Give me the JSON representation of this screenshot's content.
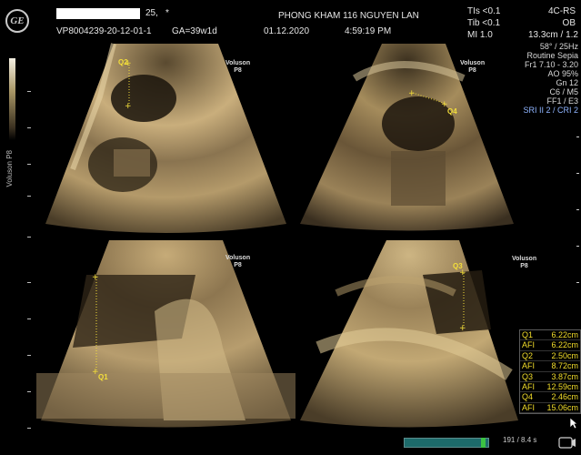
{
  "header": {
    "patient_suffix": "25,",
    "asterisk": "*",
    "patient_id": "VP8004239-20-12-01-1",
    "ga": "GA=39w1d",
    "clinic": "PHONG KHAM 116 NGUYEN LAN",
    "date": "01.12.2020",
    "time": "4:59:19 PM",
    "tis": "TIs <0.1",
    "tib": "Tib <0.1",
    "mi": "MI  1.0",
    "probe": "4C-RS",
    "preset": "OB",
    "depth": "13.3cm / 1.2"
  },
  "params": [
    "58° / 25Hz",
    "Routine Sepia",
    "Fr1 7.10 - 3.20",
    "AO 95%",
    "Gn 12",
    "C6 / M5",
    "FF1 / E3",
    "SRI II 2 / CRI 2"
  ],
  "probe_label": {
    "brand": "Voluson",
    "model": "P8"
  },
  "calipers": [
    "Q1",
    "Q2",
    "Q3",
    "Q4"
  ],
  "measurements": [
    {
      "label": "Q1",
      "value": "6.22cm"
    },
    {
      "label": "AFI",
      "value": "6.22cm"
    },
    {
      "label": "Q2",
      "value": "2.50cm"
    },
    {
      "label": "AFI",
      "value": "8.72cm"
    },
    {
      "label": "Q3",
      "value": "3.87cm"
    },
    {
      "label": "AFI",
      "value": "12.59cm"
    },
    {
      "label": "Q4",
      "value": "2.46cm"
    },
    {
      "label": "AFI",
      "value": "15.06cm"
    }
  ],
  "cine": {
    "frames": "191 / 8.4 s",
    "fill_fraction": 0.95
  },
  "icons": [
    "ge-logo-icon",
    "cursor-arrow-icon",
    "clip-icon"
  ]
}
